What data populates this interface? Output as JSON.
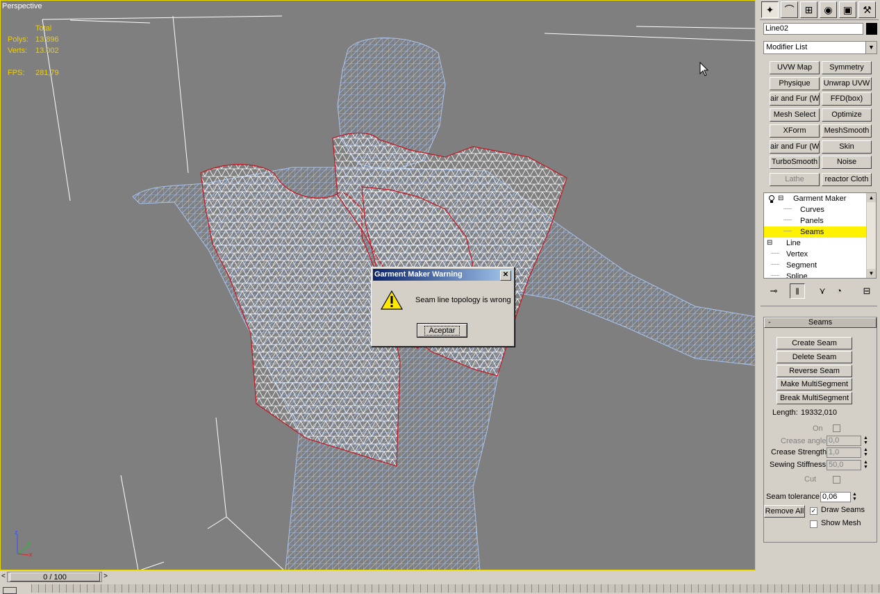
{
  "viewport": {
    "label": "Perspective",
    "stats": {
      "total_label": "Total",
      "polys_label": "Polys:",
      "polys_value": "13.896",
      "verts_label": "Verts:",
      "verts_value": "13.002",
      "fps_label": "FPS:",
      "fps_value": "281,79"
    },
    "axis": {
      "x": "x",
      "y": "y",
      "z": "z"
    },
    "colors": {
      "background": "#7f7f7f",
      "mesh": "#a9c4f0",
      "panel_mesh": "#ffffff",
      "seam": "#c8141e",
      "border": "#e8d800"
    }
  },
  "dialog": {
    "title": "Garment Maker Warning",
    "close": "✕",
    "message": "Seam line topology is wrong",
    "ok_label": "Aceptar"
  },
  "timeline": {
    "frame": "0 / 100",
    "prev": "<",
    "next": ">"
  },
  "panel": {
    "object_name": "Line02",
    "modifier_list": "Modifier List",
    "modifier_buttons": [
      {
        "label": "UVW Map",
        "enabled": true
      },
      {
        "label": "Symmetry",
        "enabled": true
      },
      {
        "label": "Physique",
        "enabled": true
      },
      {
        "label": "Unwrap UVW",
        "enabled": true
      },
      {
        "label": "air and Fur (WS",
        "enabled": true
      },
      {
        "label": "FFD(box)",
        "enabled": true
      },
      {
        "label": "Mesh Select",
        "enabled": true
      },
      {
        "label": "Optimize",
        "enabled": true
      },
      {
        "label": "XForm",
        "enabled": true
      },
      {
        "label": "MeshSmooth",
        "enabled": true
      },
      {
        "label": "air and Fur (WS",
        "enabled": true
      },
      {
        "label": "Skin",
        "enabled": true
      },
      {
        "label": "TurboSmooth",
        "enabled": true
      },
      {
        "label": "Noise",
        "enabled": true
      },
      {
        "label": "Lathe",
        "enabled": false
      },
      {
        "label": "reactor Cloth",
        "enabled": true
      }
    ],
    "stack": [
      {
        "label": "Garment Maker",
        "level": 0,
        "selected": false
      },
      {
        "label": "Curves",
        "level": 1,
        "selected": false
      },
      {
        "label": "Panels",
        "level": 1,
        "selected": false
      },
      {
        "label": "Seams",
        "level": 1,
        "selected": true
      },
      {
        "label": "Line",
        "level": 0,
        "selected": false
      },
      {
        "label": "Vertex",
        "level": 1,
        "selected": false
      },
      {
        "label": "Segment",
        "level": 1,
        "selected": false
      },
      {
        "label": "Spline",
        "level": 1,
        "selected": false
      }
    ],
    "rollout": {
      "title": "Seams",
      "collapse": "-",
      "buttons": [
        "Create Seam",
        "Delete Seam",
        "Reverse Seam",
        "Make MultiSegment",
        "Break MultiSegment"
      ],
      "length_label": "Length:",
      "length_value": "19332,010",
      "on_label": "On",
      "crease_angle_label": "Crease angle",
      "crease_angle_value": "0,0",
      "crease_strength_label": "Crease Strength",
      "crease_strength_value": "1,0",
      "sewing_stiffness_label": "Sewing Stiffness",
      "sewing_stiffness_value": "50,0",
      "cut_label": "Cut",
      "seam_tolerance_label": "Seam tolerance",
      "seam_tolerance_value": "0,06",
      "remove_all_label": "Remove All",
      "draw_seams_label": "Draw Seams",
      "draw_seams_checked": true,
      "show_mesh_label": "Show Mesh",
      "show_mesh_checked": false
    }
  }
}
